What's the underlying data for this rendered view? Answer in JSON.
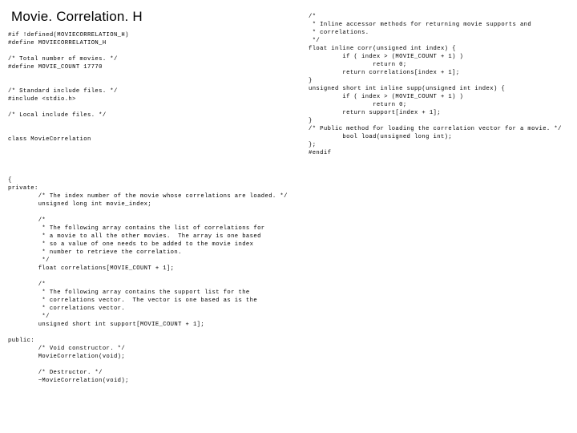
{
  "title": "Movie. Correlation. H",
  "left_block": "#if !defined(MOVIECORRELATION_H)\n#define MOVIECORRELATION_H\n\n/* Total number of movies. */\n#define MOVIE_COUNT 17770\n\n\n/* Standard include files. */\n#include <stdio.h>\n\n/* Local include files. */\n\n\nclass MovieCorrelation",
  "right_block": "/*\n * Inline accessor methods for returning movie supports and\n * correlations.\n */\nfloat inline corr(unsigned int index) {\n         if ( index > (MOVIE_COUNT + 1) )\n                 return 0;\n         return correlations[index + 1];\n}\nunsigned short int inline supp(unsigned int index) {\n         if ( index > (MOVIE_COUNT + 1) )\n                 return 0;\n         return support[index + 1];\n}\n/* Public method for loading the correlation vector for a movie. */\n         bool load(unsigned long int);\n};\n#endif",
  "bottom_block": "{\nprivate:\n        /* The index number of the movie whose correlations are loaded. */\n        unsigned long int movie_index;\n\n        /*\n         * The following array contains the list of correlations for\n         * a movie to all the other movies.  The array is one based\n         * so a value of one needs to be added to the movie index\n         * number to retrieve the correlation.\n         */\n        float correlations[MOVIE_COUNT + 1];\n\n        /*\n         * The following array contains the support list for the\n         * correlations vector.  The vector is one based as is the\n         * correlations vector.\n         */\n        unsigned short int support[MOVIE_COUNT + 1];\n\npublic:\n        /* Void constructor. */\n        MovieCorrelation(void);\n\n        /* Destructor. */\n        ~MovieCorrelation(void);"
}
